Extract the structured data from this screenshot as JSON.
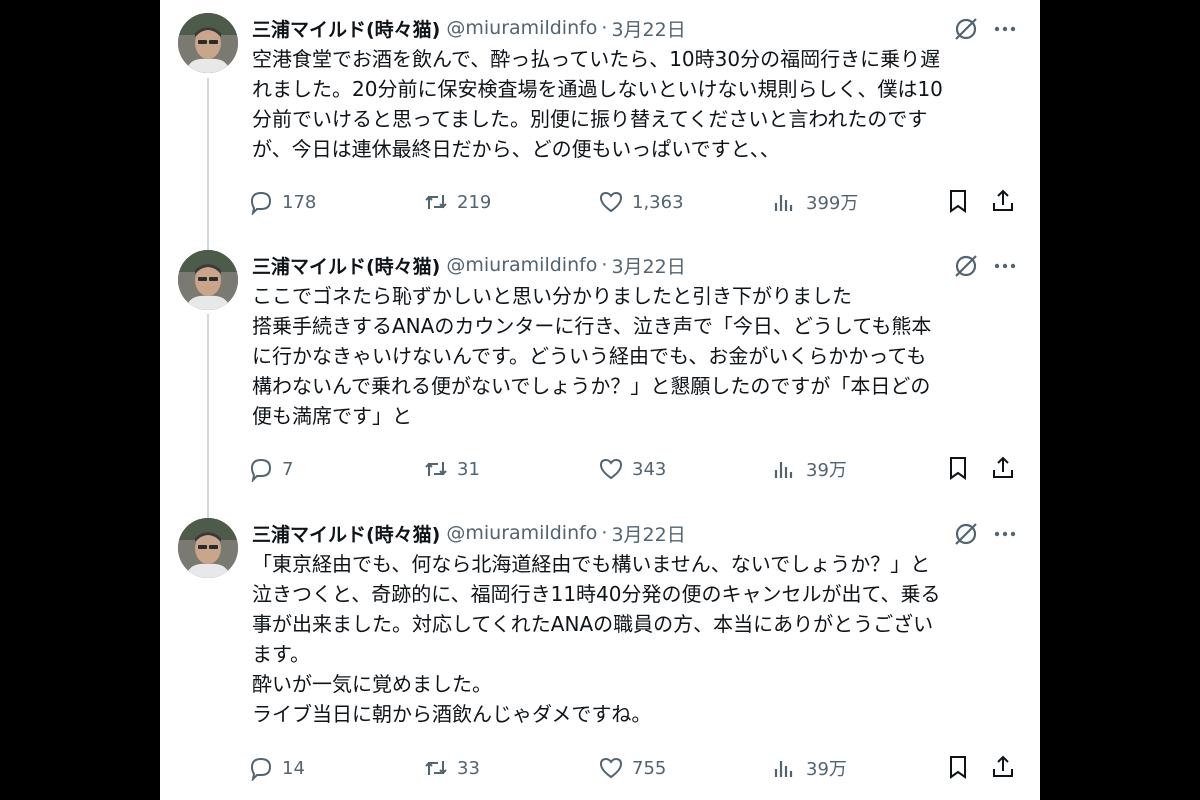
{
  "tweets": [
    {
      "name": "三浦マイルド(時々猫)",
      "handle": "@miuramildinfo",
      "separator": "·",
      "date": "3月22日",
      "lines": [
        "空港食堂でお酒を飲んで、酔っ払っていたら、10時30分の福岡行きに乗り遅",
        "れました。20分前に保安検査場を通過しないといけない規則らしく、僕は10",
        "分前でいけると思ってました。別便に振り替えてくださいと言われたのです",
        "が、今日は連休最終日だから、どの便もいっぱいですと、、"
      ],
      "replies": "178",
      "reposts": "219",
      "likes": "1,363",
      "views": "399万"
    },
    {
      "name": "三浦マイルド(時々猫)",
      "handle": "@miuramildinfo",
      "separator": "·",
      "date": "3月22日",
      "lines": [
        "ここでゴネたら恥ずかしいと思い分かりましたと引き下がりました",
        "搭乗手続きするANAのカウンターに行き、泣き声で「今日、どうしても熊本",
        "に行かなきゃいけないんです。どういう経由でも、お金がいくらかかっても",
        "構わないんで乗れる便がないでしょうか？」と懇願したのですが「本日どの",
        "便も満席です」と"
      ],
      "replies": "7",
      "reposts": "31",
      "likes": "343",
      "views": "39万"
    },
    {
      "name": "三浦マイルド(時々猫)",
      "handle": "@miuramildinfo",
      "separator": "·",
      "date": "3月22日",
      "lines": [
        "「東京経由でも、何なら北海道経由でも構いません、ないでしょうか？」と",
        "泣きつくと、奇跡的に、福岡行き11時40分発の便のキャンセルが出て、乗る",
        "事が出来ました。対応してくれたANAの職員の方、本当にありがとうござい",
        "ます。",
        "酔いが一気に覚めました。",
        "ライブ当日に朝から酒飲んじゃダメですね。"
      ],
      "replies": "14",
      "reposts": "33",
      "likes": "755",
      "views": "39万"
    }
  ],
  "icons": {
    "reply": "reply-icon",
    "repost": "repost-icon",
    "like": "heart-icon",
    "views": "views-icon",
    "bookmark": "bookmark-icon",
    "share": "share-icon",
    "grok": "grok-icon",
    "more": "more-icon"
  },
  "colors": {
    "text": "#0f1419",
    "muted": "#536471",
    "thread_line": "#cfd9de"
  }
}
